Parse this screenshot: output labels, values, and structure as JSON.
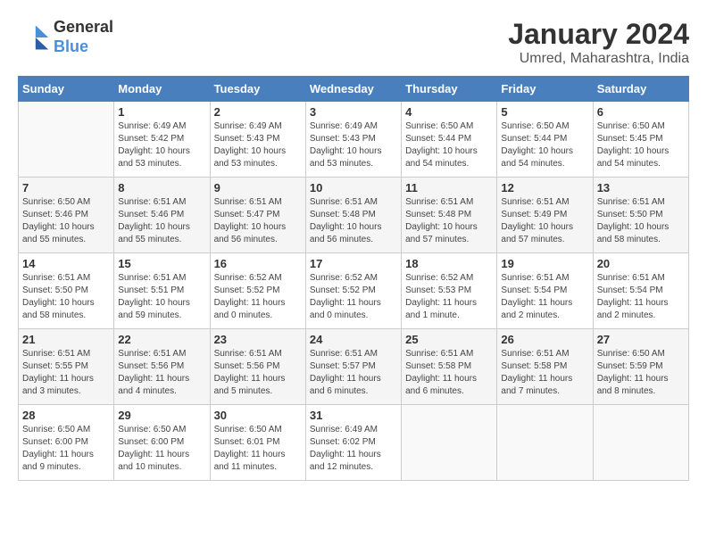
{
  "header": {
    "logo_line1": "General",
    "logo_line2": "Blue",
    "month": "January 2024",
    "location": "Umred, Maharashtra, India"
  },
  "weekdays": [
    "Sunday",
    "Monday",
    "Tuesday",
    "Wednesday",
    "Thursday",
    "Friday",
    "Saturday"
  ],
  "weeks": [
    [
      {
        "day": "",
        "sunrise": "",
        "sunset": "",
        "daylight": ""
      },
      {
        "day": "1",
        "sunrise": "Sunrise: 6:49 AM",
        "sunset": "Sunset: 5:42 PM",
        "daylight": "Daylight: 10 hours and 53 minutes."
      },
      {
        "day": "2",
        "sunrise": "Sunrise: 6:49 AM",
        "sunset": "Sunset: 5:43 PM",
        "daylight": "Daylight: 10 hours and 53 minutes."
      },
      {
        "day": "3",
        "sunrise": "Sunrise: 6:49 AM",
        "sunset": "Sunset: 5:43 PM",
        "daylight": "Daylight: 10 hours and 53 minutes."
      },
      {
        "day": "4",
        "sunrise": "Sunrise: 6:50 AM",
        "sunset": "Sunset: 5:44 PM",
        "daylight": "Daylight: 10 hours and 54 minutes."
      },
      {
        "day": "5",
        "sunrise": "Sunrise: 6:50 AM",
        "sunset": "Sunset: 5:44 PM",
        "daylight": "Daylight: 10 hours and 54 minutes."
      },
      {
        "day": "6",
        "sunrise": "Sunrise: 6:50 AM",
        "sunset": "Sunset: 5:45 PM",
        "daylight": "Daylight: 10 hours and 54 minutes."
      }
    ],
    [
      {
        "day": "7",
        "sunrise": "Sunrise: 6:50 AM",
        "sunset": "Sunset: 5:46 PM",
        "daylight": "Daylight: 10 hours and 55 minutes."
      },
      {
        "day": "8",
        "sunrise": "Sunrise: 6:51 AM",
        "sunset": "Sunset: 5:46 PM",
        "daylight": "Daylight: 10 hours and 55 minutes."
      },
      {
        "day": "9",
        "sunrise": "Sunrise: 6:51 AM",
        "sunset": "Sunset: 5:47 PM",
        "daylight": "Daylight: 10 hours and 56 minutes."
      },
      {
        "day": "10",
        "sunrise": "Sunrise: 6:51 AM",
        "sunset": "Sunset: 5:48 PM",
        "daylight": "Daylight: 10 hours and 56 minutes."
      },
      {
        "day": "11",
        "sunrise": "Sunrise: 6:51 AM",
        "sunset": "Sunset: 5:48 PM",
        "daylight": "Daylight: 10 hours and 57 minutes."
      },
      {
        "day": "12",
        "sunrise": "Sunrise: 6:51 AM",
        "sunset": "Sunset: 5:49 PM",
        "daylight": "Daylight: 10 hours and 57 minutes."
      },
      {
        "day": "13",
        "sunrise": "Sunrise: 6:51 AM",
        "sunset": "Sunset: 5:50 PM",
        "daylight": "Daylight: 10 hours and 58 minutes."
      }
    ],
    [
      {
        "day": "14",
        "sunrise": "Sunrise: 6:51 AM",
        "sunset": "Sunset: 5:50 PM",
        "daylight": "Daylight: 10 hours and 58 minutes."
      },
      {
        "day": "15",
        "sunrise": "Sunrise: 6:51 AM",
        "sunset": "Sunset: 5:51 PM",
        "daylight": "Daylight: 10 hours and 59 minutes."
      },
      {
        "day": "16",
        "sunrise": "Sunrise: 6:52 AM",
        "sunset": "Sunset: 5:52 PM",
        "daylight": "Daylight: 11 hours and 0 minutes."
      },
      {
        "day": "17",
        "sunrise": "Sunrise: 6:52 AM",
        "sunset": "Sunset: 5:52 PM",
        "daylight": "Daylight: 11 hours and 0 minutes."
      },
      {
        "day": "18",
        "sunrise": "Sunrise: 6:52 AM",
        "sunset": "Sunset: 5:53 PM",
        "daylight": "Daylight: 11 hours and 1 minute."
      },
      {
        "day": "19",
        "sunrise": "Sunrise: 6:51 AM",
        "sunset": "Sunset: 5:54 PM",
        "daylight": "Daylight: 11 hours and 2 minutes."
      },
      {
        "day": "20",
        "sunrise": "Sunrise: 6:51 AM",
        "sunset": "Sunset: 5:54 PM",
        "daylight": "Daylight: 11 hours and 2 minutes."
      }
    ],
    [
      {
        "day": "21",
        "sunrise": "Sunrise: 6:51 AM",
        "sunset": "Sunset: 5:55 PM",
        "daylight": "Daylight: 11 hours and 3 minutes."
      },
      {
        "day": "22",
        "sunrise": "Sunrise: 6:51 AM",
        "sunset": "Sunset: 5:56 PM",
        "daylight": "Daylight: 11 hours and 4 minutes."
      },
      {
        "day": "23",
        "sunrise": "Sunrise: 6:51 AM",
        "sunset": "Sunset: 5:56 PM",
        "daylight": "Daylight: 11 hours and 5 minutes."
      },
      {
        "day": "24",
        "sunrise": "Sunrise: 6:51 AM",
        "sunset": "Sunset: 5:57 PM",
        "daylight": "Daylight: 11 hours and 6 minutes."
      },
      {
        "day": "25",
        "sunrise": "Sunrise: 6:51 AM",
        "sunset": "Sunset: 5:58 PM",
        "daylight": "Daylight: 11 hours and 6 minutes."
      },
      {
        "day": "26",
        "sunrise": "Sunrise: 6:51 AM",
        "sunset": "Sunset: 5:58 PM",
        "daylight": "Daylight: 11 hours and 7 minutes."
      },
      {
        "day": "27",
        "sunrise": "Sunrise: 6:50 AM",
        "sunset": "Sunset: 5:59 PM",
        "daylight": "Daylight: 11 hours and 8 minutes."
      }
    ],
    [
      {
        "day": "28",
        "sunrise": "Sunrise: 6:50 AM",
        "sunset": "Sunset: 6:00 PM",
        "daylight": "Daylight: 11 hours and 9 minutes."
      },
      {
        "day": "29",
        "sunrise": "Sunrise: 6:50 AM",
        "sunset": "Sunset: 6:00 PM",
        "daylight": "Daylight: 11 hours and 10 minutes."
      },
      {
        "day": "30",
        "sunrise": "Sunrise: 6:50 AM",
        "sunset": "Sunset: 6:01 PM",
        "daylight": "Daylight: 11 hours and 11 minutes."
      },
      {
        "day": "31",
        "sunrise": "Sunrise: 6:49 AM",
        "sunset": "Sunset: 6:02 PM",
        "daylight": "Daylight: 11 hours and 12 minutes."
      },
      {
        "day": "",
        "sunrise": "",
        "sunset": "",
        "daylight": ""
      },
      {
        "day": "",
        "sunrise": "",
        "sunset": "",
        "daylight": ""
      },
      {
        "day": "",
        "sunrise": "",
        "sunset": "",
        "daylight": ""
      }
    ]
  ]
}
